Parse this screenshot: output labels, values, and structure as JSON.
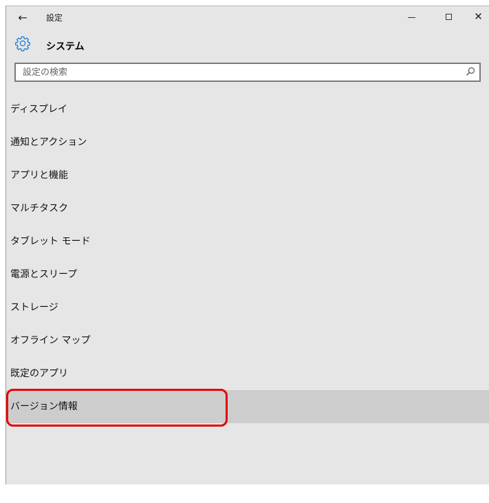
{
  "window": {
    "title": "設定",
    "back_icon": "arrow-left-icon",
    "min_icon": "minimize-icon",
    "max_icon": "maximize-icon",
    "close_icon": "close-icon"
  },
  "header": {
    "icon": "gear-icon",
    "title": "システム",
    "accent_color": "#1f7bd1"
  },
  "search": {
    "placeholder": "設定の検索",
    "value": "",
    "icon": "search-icon"
  },
  "nav": {
    "items": [
      {
        "label": "ディスプレイ",
        "selected": false
      },
      {
        "label": "通知とアクション",
        "selected": false
      },
      {
        "label": "アプリと機能",
        "selected": false
      },
      {
        "label": "マルチタスク",
        "selected": false
      },
      {
        "label": "タブレット モード",
        "selected": false
      },
      {
        "label": "電源とスリープ",
        "selected": false
      },
      {
        "label": "ストレージ",
        "selected": false
      },
      {
        "label": "オフライン マップ",
        "selected": false
      },
      {
        "label": "既定のアプリ",
        "selected": false
      },
      {
        "label": "バージョン情報",
        "selected": true
      }
    ]
  },
  "annotation": {
    "highlight_color": "#e60000",
    "target": "バージョン情報"
  }
}
